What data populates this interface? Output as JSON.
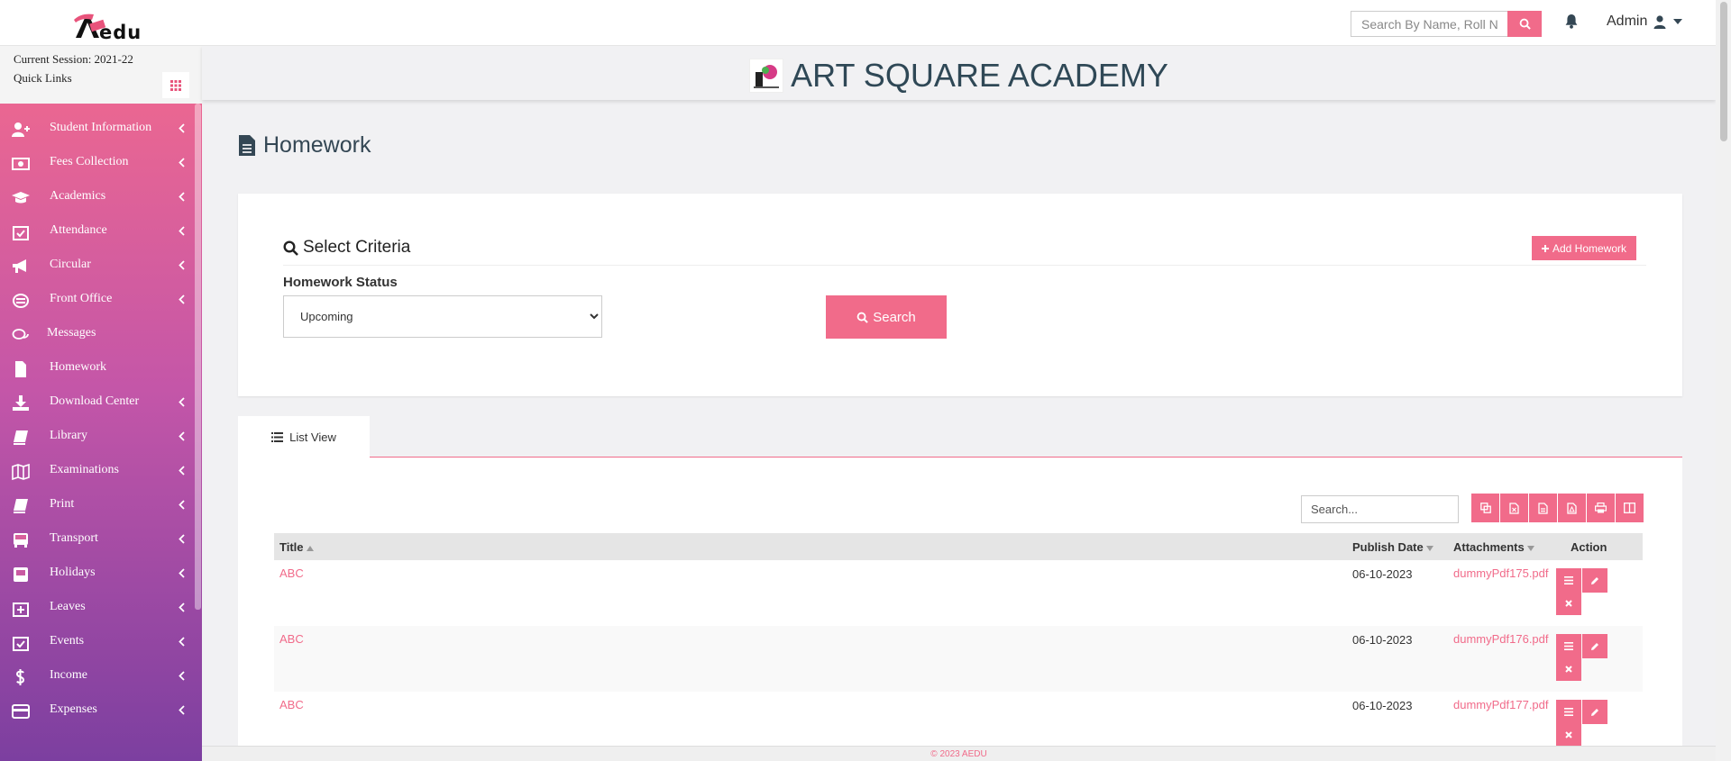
{
  "app": {
    "logo_text": "edu"
  },
  "topbar": {
    "search_placeholder": "Search By Name, Roll Number",
    "user_name": "Admin"
  },
  "session": {
    "current": "Current Session: 2021-22",
    "quick_links": "Quick Links"
  },
  "sidebar": {
    "items": [
      {
        "label": "Student Information",
        "icon": "user-plus-icon"
      },
      {
        "label": "Fees Collection",
        "icon": "money-icon"
      },
      {
        "label": "Academics",
        "icon": "graduation-cap-icon"
      },
      {
        "label": "Attendance",
        "icon": "calendar-check-icon"
      },
      {
        "label": "Circular",
        "icon": "bullhorn-icon"
      },
      {
        "label": "Front Office",
        "icon": "front-office-icon"
      },
      {
        "label": "Messages",
        "icon": "comments-icon"
      },
      {
        "label": "Homework",
        "icon": "file-text-icon"
      },
      {
        "label": "Download Center",
        "icon": "download-icon"
      },
      {
        "label": "Library",
        "icon": "book-icon"
      },
      {
        "label": "Examinations",
        "icon": "map-icon"
      },
      {
        "label": "Print",
        "icon": "print-book-icon"
      },
      {
        "label": "Transport",
        "icon": "bus-icon"
      },
      {
        "label": "Holidays",
        "icon": "holiday-icon"
      },
      {
        "label": "Leaves",
        "icon": "calendar-plus-icon"
      },
      {
        "label": "Events",
        "icon": "calendar-check-icon"
      },
      {
        "label": "Income",
        "icon": "dollar-icon"
      },
      {
        "label": "Expenses",
        "icon": "credit-card-icon"
      }
    ]
  },
  "school": {
    "name": "ART SQUARE ACADEMY"
  },
  "page": {
    "title": "Homework"
  },
  "criteria": {
    "title": "Select Criteria",
    "add_button": "Add Homework",
    "status_label": "Homework Status",
    "status_value": "Upcoming",
    "search_button": "Search"
  },
  "tabs": {
    "list_view": "List View"
  },
  "table": {
    "search_placeholder": "Search...",
    "export_buttons": [
      "copy-icon",
      "excel-icon",
      "csv-icon",
      "pdf-icon",
      "print-icon",
      "columns-icon"
    ],
    "columns": {
      "title": "Title",
      "publish_date": "Publish Date",
      "attachments": "Attachments",
      "action": "Action"
    },
    "rows": [
      {
        "title": "ABC",
        "publish_date": "06-10-2023",
        "attachment": "dummyPdf175.pdf"
      },
      {
        "title": "ABC",
        "publish_date": "06-10-2023",
        "attachment": "dummyPdf176.pdf"
      },
      {
        "title": "ABC",
        "publish_date": "06-10-2023",
        "attachment": "dummyPdf177.pdf"
      }
    ]
  },
  "footer": {
    "text": "© 2023 AEDU"
  },
  "colors": {
    "accent": "#f16b8a",
    "sidebar_top": "#f26a8d",
    "sidebar_bottom": "#7c3fa0",
    "heading": "#344754"
  }
}
